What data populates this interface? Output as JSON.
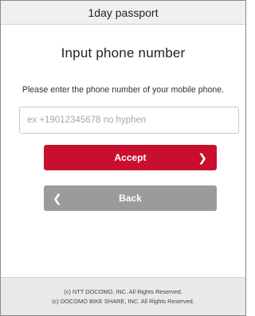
{
  "header": {
    "title": "1day passport"
  },
  "main": {
    "title": "Input phone number",
    "instruction": "Please enter the phone number of your mobile phone.",
    "phone_input": {
      "value": "",
      "placeholder": "ex +19012345678 no hyphen"
    },
    "accept_button": {
      "label": "Accept",
      "icon": "chevron-right-icon"
    },
    "back_button": {
      "label": "Back",
      "icon": "chevron-left-icon"
    }
  },
  "footer": {
    "copyright_1": "(c) NTT DOCOMO, INC. All Rights Reserved.",
    "copyright_2": "(c) DOCOMO BIKE SHARE, INC. All Rights Reserved."
  },
  "colors": {
    "accent": "#c8102e",
    "secondary_button": "#9b9b9b",
    "header_bg": "#f0f0f0",
    "footer_bg": "#e9e9e9"
  }
}
